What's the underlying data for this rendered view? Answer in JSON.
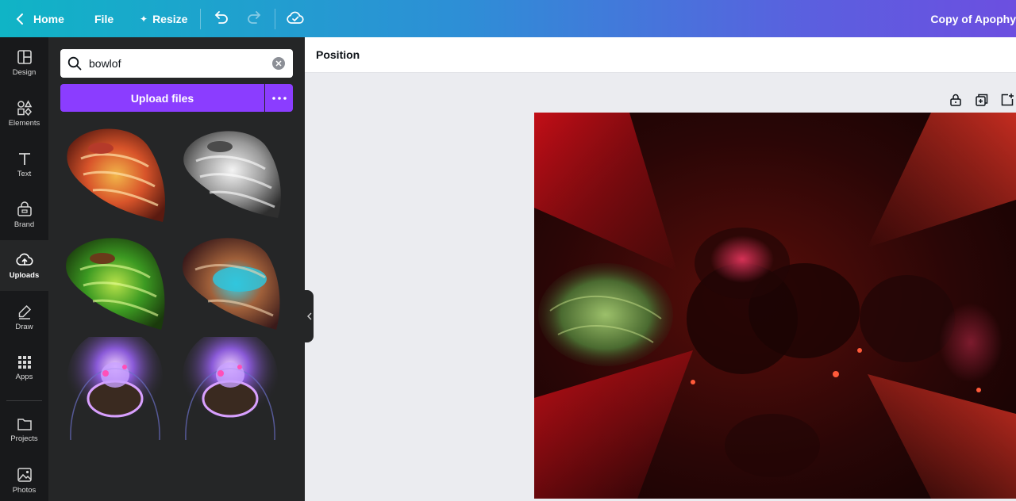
{
  "topbar": {
    "home_label": "Home",
    "file_label": "File",
    "resize_label": "Resize",
    "doc_title": "Copy of Apophy"
  },
  "nav": [
    {
      "label": "Design",
      "icon": "layout-icon"
    },
    {
      "label": "Elements",
      "icon": "shapes-icon"
    },
    {
      "label": "Text",
      "icon": "text-icon"
    },
    {
      "label": "Brand",
      "icon": "brand-icon"
    },
    {
      "label": "Uploads",
      "icon": "cloud-upload-icon",
      "active": true
    },
    {
      "label": "Draw",
      "icon": "pen-icon"
    },
    {
      "label": "Apps",
      "icon": "grid-icon"
    },
    {
      "label": "Projects",
      "icon": "folder-icon"
    },
    {
      "label": "Photos",
      "icon": "image-icon"
    }
  ],
  "panel": {
    "search_value": "bowlof",
    "upload_label": "Upload files"
  },
  "editor": {
    "position_label": "Position"
  },
  "colors": {
    "accent": "#8b3dff",
    "panel_bg": "#252627",
    "nav_bg": "#18191b"
  }
}
